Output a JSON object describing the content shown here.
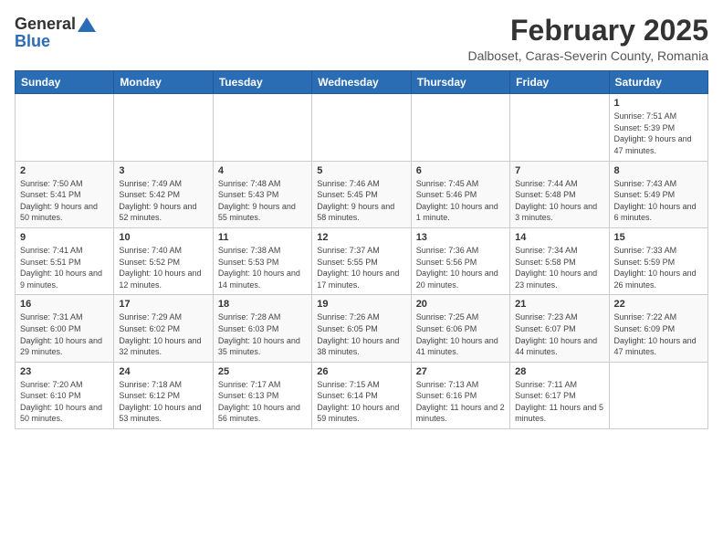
{
  "header": {
    "logo_line1": "General",
    "logo_line2": "Blue",
    "main_title": "February 2025",
    "subtitle": "Dalboset, Caras-Severin County, Romania"
  },
  "weekdays": [
    "Sunday",
    "Monday",
    "Tuesday",
    "Wednesday",
    "Thursday",
    "Friday",
    "Saturday"
  ],
  "weeks": [
    [
      {
        "day": "",
        "info": ""
      },
      {
        "day": "",
        "info": ""
      },
      {
        "day": "",
        "info": ""
      },
      {
        "day": "",
        "info": ""
      },
      {
        "day": "",
        "info": ""
      },
      {
        "day": "",
        "info": ""
      },
      {
        "day": "1",
        "info": "Sunrise: 7:51 AM\nSunset: 5:39 PM\nDaylight: 9 hours and 47 minutes."
      }
    ],
    [
      {
        "day": "2",
        "info": "Sunrise: 7:50 AM\nSunset: 5:41 PM\nDaylight: 9 hours and 50 minutes."
      },
      {
        "day": "3",
        "info": "Sunrise: 7:49 AM\nSunset: 5:42 PM\nDaylight: 9 hours and 52 minutes."
      },
      {
        "day": "4",
        "info": "Sunrise: 7:48 AM\nSunset: 5:43 PM\nDaylight: 9 hours and 55 minutes."
      },
      {
        "day": "5",
        "info": "Sunrise: 7:46 AM\nSunset: 5:45 PM\nDaylight: 9 hours and 58 minutes."
      },
      {
        "day": "6",
        "info": "Sunrise: 7:45 AM\nSunset: 5:46 PM\nDaylight: 10 hours and 1 minute."
      },
      {
        "day": "7",
        "info": "Sunrise: 7:44 AM\nSunset: 5:48 PM\nDaylight: 10 hours and 3 minutes."
      },
      {
        "day": "8",
        "info": "Sunrise: 7:43 AM\nSunset: 5:49 PM\nDaylight: 10 hours and 6 minutes."
      }
    ],
    [
      {
        "day": "9",
        "info": "Sunrise: 7:41 AM\nSunset: 5:51 PM\nDaylight: 10 hours and 9 minutes."
      },
      {
        "day": "10",
        "info": "Sunrise: 7:40 AM\nSunset: 5:52 PM\nDaylight: 10 hours and 12 minutes."
      },
      {
        "day": "11",
        "info": "Sunrise: 7:38 AM\nSunset: 5:53 PM\nDaylight: 10 hours and 14 minutes."
      },
      {
        "day": "12",
        "info": "Sunrise: 7:37 AM\nSunset: 5:55 PM\nDaylight: 10 hours and 17 minutes."
      },
      {
        "day": "13",
        "info": "Sunrise: 7:36 AM\nSunset: 5:56 PM\nDaylight: 10 hours and 20 minutes."
      },
      {
        "day": "14",
        "info": "Sunrise: 7:34 AM\nSunset: 5:58 PM\nDaylight: 10 hours and 23 minutes."
      },
      {
        "day": "15",
        "info": "Sunrise: 7:33 AM\nSunset: 5:59 PM\nDaylight: 10 hours and 26 minutes."
      }
    ],
    [
      {
        "day": "16",
        "info": "Sunrise: 7:31 AM\nSunset: 6:00 PM\nDaylight: 10 hours and 29 minutes."
      },
      {
        "day": "17",
        "info": "Sunrise: 7:29 AM\nSunset: 6:02 PM\nDaylight: 10 hours and 32 minutes."
      },
      {
        "day": "18",
        "info": "Sunrise: 7:28 AM\nSunset: 6:03 PM\nDaylight: 10 hours and 35 minutes."
      },
      {
        "day": "19",
        "info": "Sunrise: 7:26 AM\nSunset: 6:05 PM\nDaylight: 10 hours and 38 minutes."
      },
      {
        "day": "20",
        "info": "Sunrise: 7:25 AM\nSunset: 6:06 PM\nDaylight: 10 hours and 41 minutes."
      },
      {
        "day": "21",
        "info": "Sunrise: 7:23 AM\nSunset: 6:07 PM\nDaylight: 10 hours and 44 minutes."
      },
      {
        "day": "22",
        "info": "Sunrise: 7:22 AM\nSunset: 6:09 PM\nDaylight: 10 hours and 47 minutes."
      }
    ],
    [
      {
        "day": "23",
        "info": "Sunrise: 7:20 AM\nSunset: 6:10 PM\nDaylight: 10 hours and 50 minutes."
      },
      {
        "day": "24",
        "info": "Sunrise: 7:18 AM\nSunset: 6:12 PM\nDaylight: 10 hours and 53 minutes."
      },
      {
        "day": "25",
        "info": "Sunrise: 7:17 AM\nSunset: 6:13 PM\nDaylight: 10 hours and 56 minutes."
      },
      {
        "day": "26",
        "info": "Sunrise: 7:15 AM\nSunset: 6:14 PM\nDaylight: 10 hours and 59 minutes."
      },
      {
        "day": "27",
        "info": "Sunrise: 7:13 AM\nSunset: 6:16 PM\nDaylight: 11 hours and 2 minutes."
      },
      {
        "day": "28",
        "info": "Sunrise: 7:11 AM\nSunset: 6:17 PM\nDaylight: 11 hours and 5 minutes."
      },
      {
        "day": "",
        "info": ""
      }
    ]
  ]
}
